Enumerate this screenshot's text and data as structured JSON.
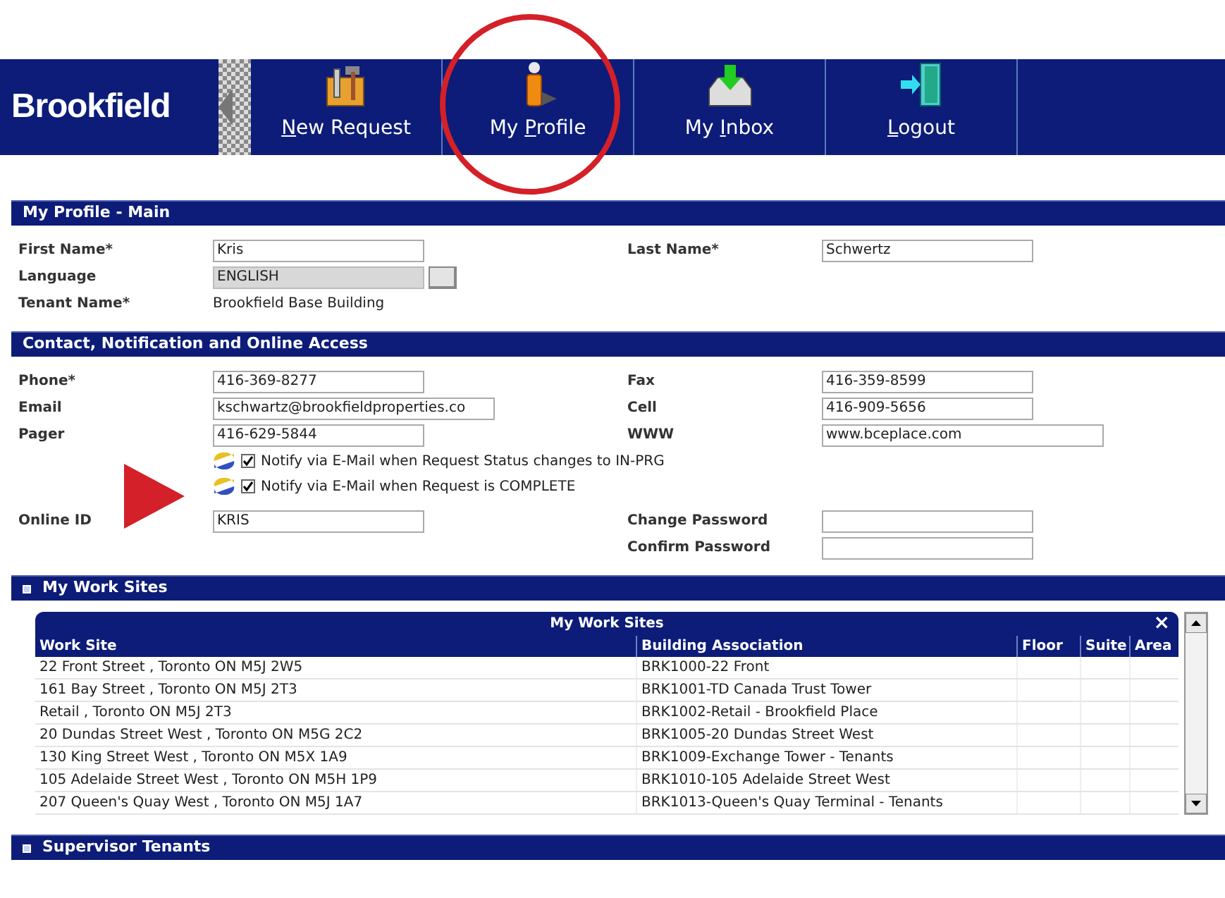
{
  "header": {
    "logo": "Brookfield",
    "tabs": [
      {
        "key": "N",
        "post": "ew Request"
      },
      {
        "pre": "My ",
        "key": "P",
        "post": "rofile"
      },
      {
        "pre": "My ",
        "key": "I",
        "post": "nbox"
      },
      {
        "key": "L",
        "post": "ogout"
      }
    ]
  },
  "sections": [
    {
      "title": "My Profile - Main",
      "bullet": false,
      "kind": "form",
      "left": [
        {
          "label": "First Name*",
          "kind": "input",
          "value": "Kris"
        },
        {
          "label": "Language",
          "kind": "lookup",
          "value": "ENGLISH"
        },
        {
          "label": "Tenant Name*",
          "kind": "text",
          "value": "Brookfield Base Building"
        }
      ],
      "right": [
        {
          "label": "Last Name*",
          "kind": "input",
          "value": "Schwertz"
        }
      ]
    },
    {
      "title": "Contact, Notification and Online Access",
      "bullet": false,
      "kind": "form",
      "left": [
        {
          "label": "Phone*",
          "kind": "input",
          "value": "416-369-8277"
        },
        {
          "label": "Email",
          "kind": "wide",
          "value": "kschwartz@brookfieldproperties.co"
        },
        {
          "label": "Pager",
          "kind": "input",
          "value": "416-629-5844"
        }
      ],
      "right": [
        {
          "label": "Fax",
          "kind": "input",
          "value": "416-359-8599"
        },
        {
          "label": "Cell",
          "kind": "input",
          "value": "416-909-5656"
        },
        {
          "label": "WWW",
          "kind": "wide",
          "value": "www.bceplace.com"
        }
      ],
      "notifications": [
        {
          "label": "Notify via E-Mail when Request Status changes to IN-PRG",
          "checked": true
        },
        {
          "label": "Notify via E-Mail when Request is COMPLETE",
          "checked": true
        }
      ],
      "left2": [
        {
          "label": "Online ID",
          "kind": "input",
          "value": "KRIS"
        }
      ],
      "right2": [
        {
          "label": "Change Password",
          "kind": "input"
        },
        {
          "label": "Confirm Password",
          "kind": "input"
        }
      ]
    },
    {
      "title": "My Work Sites",
      "bullet": true,
      "kind": "table",
      "table": {
        "title": "My Work Sites",
        "close": "×",
        "columns": [
          "Work Site",
          "Building Association",
          "Floor",
          "Suite",
          "Area"
        ],
        "rows": [
          [
            "22 Front Street , Toronto ON M5J 2W5",
            "BRK1000-22 Front"
          ],
          [
            "161 Bay Street , Toronto ON M5J 2T3",
            "BRK1001-TD Canada Trust Tower"
          ],
          [
            "Retail , Toronto ON M5J 2T3",
            "BRK1002-Retail - Brookfield Place"
          ],
          [
            "20 Dundas Street West , Toronto ON M5G 2C2",
            "BRK1005-20 Dundas Street West"
          ],
          [
            "130 King Street West , Toronto ON M5X 1A9",
            "BRK1009-Exchange Tower - Tenants"
          ],
          [
            "105 Adelaide Street West , Toronto ON M5H 1P9",
            "BRK1010-105 Adelaide Street West"
          ],
          [
            "207 Queen's Quay West , Toronto ON M5J 1A7",
            "BRK1013-Queen's Quay Terminal - Tenants"
          ]
        ]
      }
    },
    {
      "title": "Supervisor Tenants",
      "bullet": true,
      "kind": "collapsed"
    }
  ]
}
